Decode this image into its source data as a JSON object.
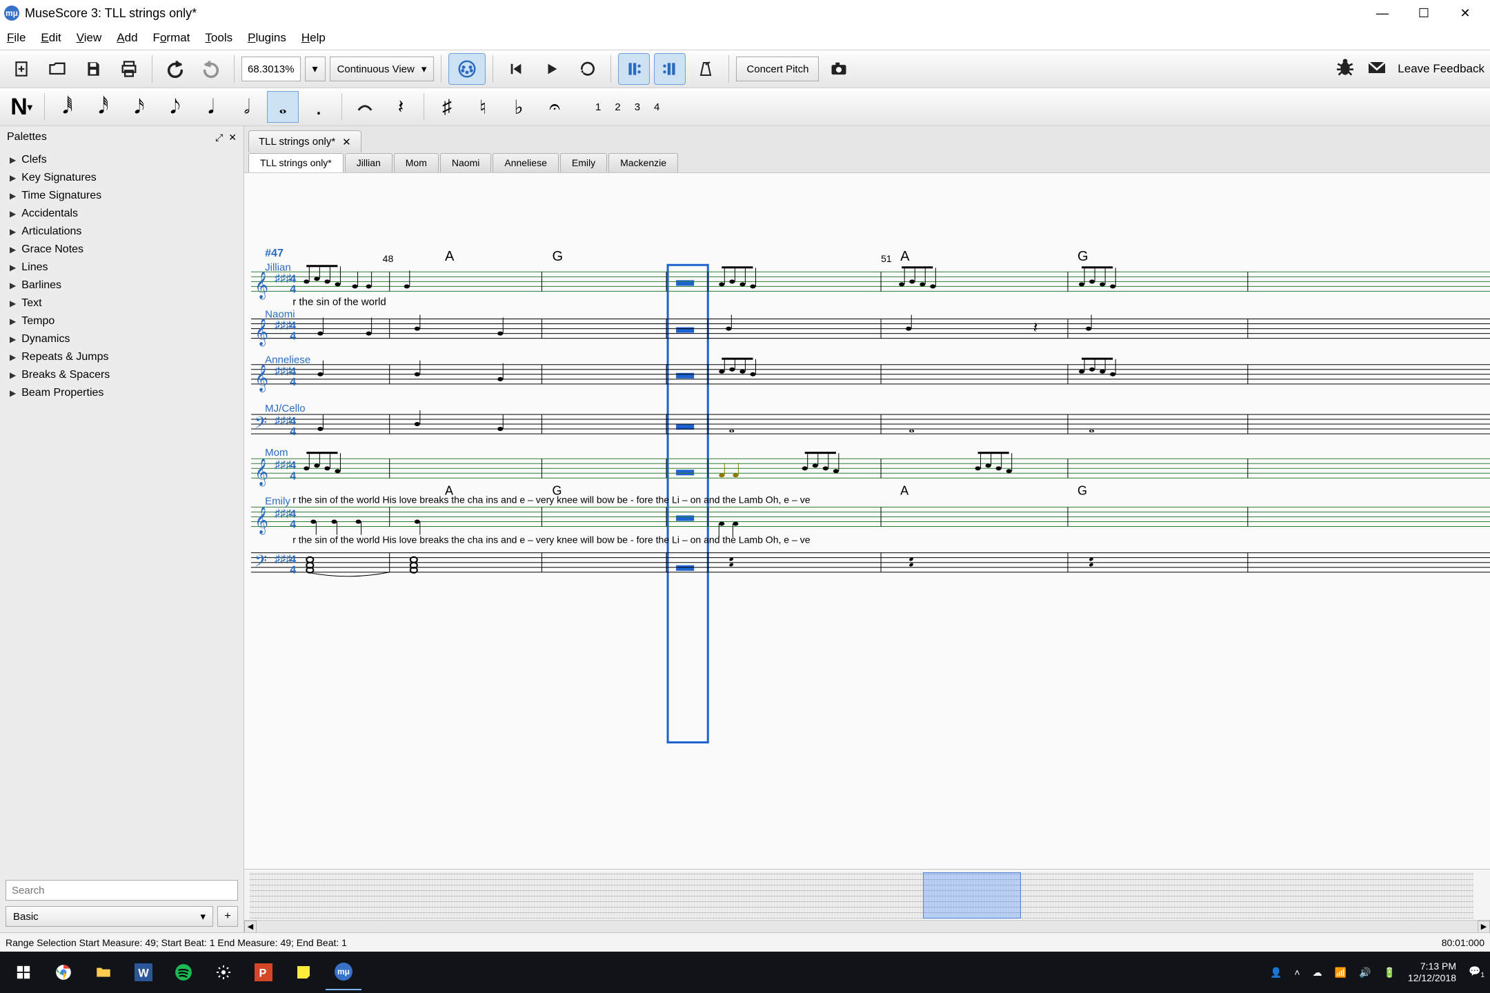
{
  "title": "MuseScore 3: TLL strings only*",
  "menu": [
    "File",
    "Edit",
    "View",
    "Add",
    "Format",
    "Tools",
    "Plugins",
    "Help"
  ],
  "zoom_value": "68.3013%",
  "view_mode": "Continuous View",
  "concert_pitch": "Concert Pitch",
  "feedback": "Leave Feedback",
  "voice_numbers": [
    "1",
    "2",
    "3",
    "4"
  ],
  "palettes_title": "Palettes",
  "palettes": [
    "Clefs",
    "Key Signatures",
    "Time Signatures",
    "Accidentals",
    "Articulations",
    "Grace Notes",
    "Lines",
    "Barlines",
    "Text",
    "Tempo",
    "Dynamics",
    "Repeats & Jumps",
    "Breaks & Spacers",
    "Beam Properties"
  ],
  "search_placeholder": "Search",
  "palette_mode": "Basic",
  "doc_tab": "TLL strings only*",
  "part_tabs": [
    "TLL strings only*",
    "Jillian",
    "Mom",
    "Naomi",
    "Anneliese",
    "Emily",
    "Mackenzie"
  ],
  "score": {
    "rehearsal": "#47",
    "measure_nums": [
      "48",
      "51"
    ],
    "chords_row1": [
      "A",
      "G",
      "A",
      "G"
    ],
    "chords_row2": [
      "A",
      "G",
      "A",
      "G"
    ],
    "staves": [
      "Jillian",
      "Naomi",
      "Anneliese",
      "MJ/Cello",
      "Mom",
      "Emily"
    ],
    "lyrics1": "r  the  sin    of    the   world",
    "lyrics2": "r  the  sin    of    the   world          His   love   breaks   the          cha   ins               and  e – very  knee   will   bow    be - fore      the  Li – on  and   the   Lamb        Oh,   e – ve",
    "lyrics3": "r  the  sin    of    the   world          His   love   breaks   the          cha   ins               and  e – very  knee   will   bow    be - fore      the  Li – on  and   the   Lamb        Oh,   e – ve"
  },
  "status_text": "Range Selection Start Measure: 49; Start Beat: 1 End Measure: 49; End Beat: 1",
  "status_time": "80:01:000",
  "taskbar": {
    "time": "7:13 PM",
    "date": "12/12/2018"
  }
}
